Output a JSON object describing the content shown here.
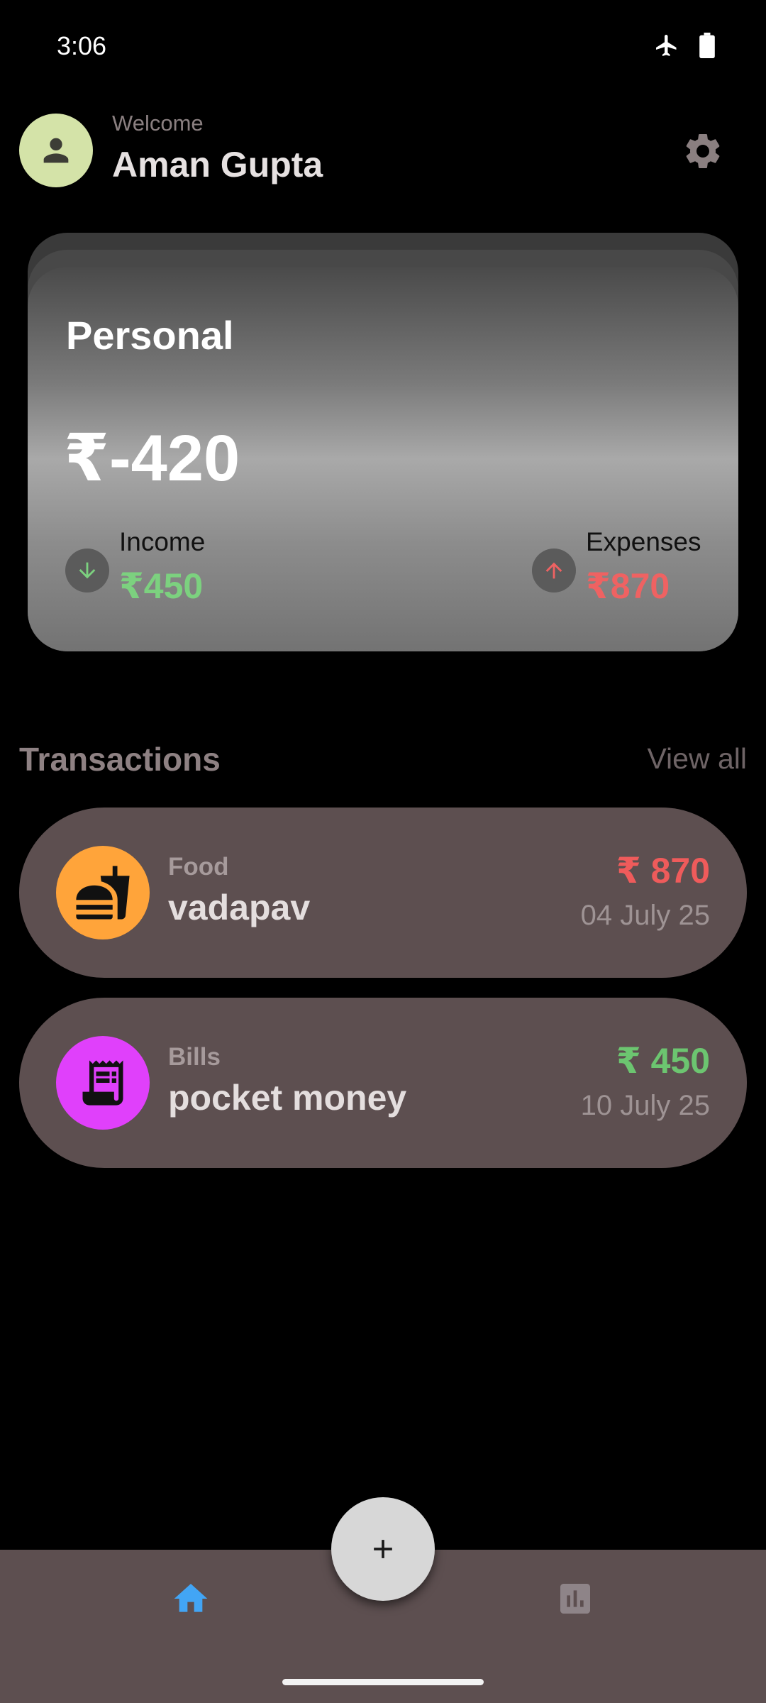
{
  "status_bar": {
    "time": "3:06"
  },
  "header": {
    "welcome": "Welcome",
    "user_name": "Aman Gupta"
  },
  "balance_card": {
    "title": "Personal",
    "balance": "₹-420",
    "income_label": "Income",
    "income_amount": "₹450",
    "expenses_label": "Expenses",
    "expenses_amount": "₹870"
  },
  "transactions": {
    "title": "Transactions",
    "view_all": "View all",
    "items": [
      {
        "category": "Food",
        "name": "vadapav",
        "amount": "₹ 870",
        "date": "04 July 25",
        "amount_color": "#ef5b5b",
        "icon": "fastfood-icon",
        "icon_bg": "#ffa43a"
      },
      {
        "category": "Bills",
        "name": "pocket money",
        "amount": "₹ 450",
        "date": "10 July 25",
        "amount_color": "#6cc570",
        "icon": "receipt-icon",
        "icon_bg": "#e040fb"
      }
    ]
  },
  "colors": {
    "background": "#000000",
    "surface": "#5d4f50",
    "accent_nav": "#42a5f5",
    "income": "#7cd17f",
    "expense": "#ef6262"
  },
  "nav": {
    "active": "home"
  }
}
